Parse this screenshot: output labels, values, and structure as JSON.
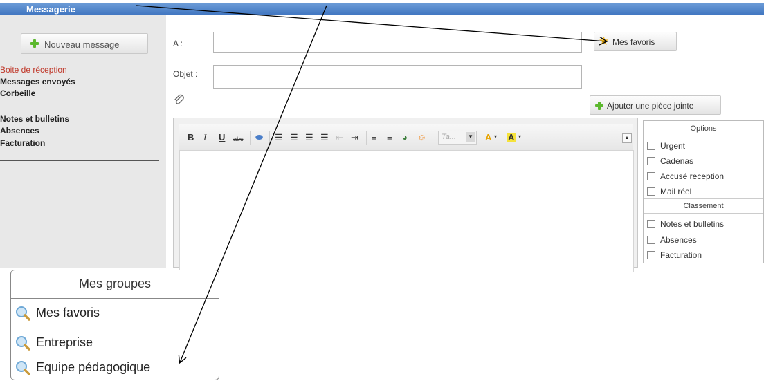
{
  "app": {
    "title": "Messagerie",
    "accent": "#4a80c8"
  },
  "sidebar": {
    "new_message_label": "Nouveau message",
    "folders": [
      {
        "label": "Boite de réception",
        "active": true
      },
      {
        "label": "Messages envoyés",
        "active": false
      },
      {
        "label": "Corbeille",
        "active": false
      }
    ],
    "categories": [
      {
        "label": "Notes et bulletins"
      },
      {
        "label": "Absences"
      },
      {
        "label": "Facturation"
      }
    ]
  },
  "compose": {
    "to_label": "A :",
    "to_value": "",
    "subject_label": "Objet :",
    "subject_value": "",
    "favorites_button": "Mes favoris",
    "attach_button": "Ajouter une pièce jointe",
    "attachment_icon": "paperclip-icon"
  },
  "editor": {
    "toolbar": {
      "bold": "B",
      "italic": "I",
      "underline": "U",
      "strike": "abc",
      "font_placeholder": "Ta...",
      "font_color_label": "A",
      "bg_color_label": "A"
    },
    "body": ""
  },
  "options": {
    "title": "Options",
    "items": [
      {
        "label": "Urgent",
        "checked": false
      },
      {
        "label": "Cadenas",
        "checked": false
      },
      {
        "label": "Accusé reception",
        "checked": false
      },
      {
        "label": "Mail réel",
        "checked": false
      }
    ],
    "classement_title": "Classement",
    "classement_items": [
      {
        "label": "Notes et bulletins",
        "checked": false
      },
      {
        "label": "Absences",
        "checked": false
      },
      {
        "label": "Facturation",
        "checked": false
      }
    ]
  },
  "groups_popup": {
    "title": "Mes groupes",
    "items": [
      {
        "label": "Mes favoris",
        "icon": "magnifier-icon"
      },
      {
        "label": "Entreprise",
        "icon": "magnifier-icon"
      },
      {
        "label": "Equipe pédagogique",
        "icon": "magnifier-icon"
      }
    ]
  }
}
